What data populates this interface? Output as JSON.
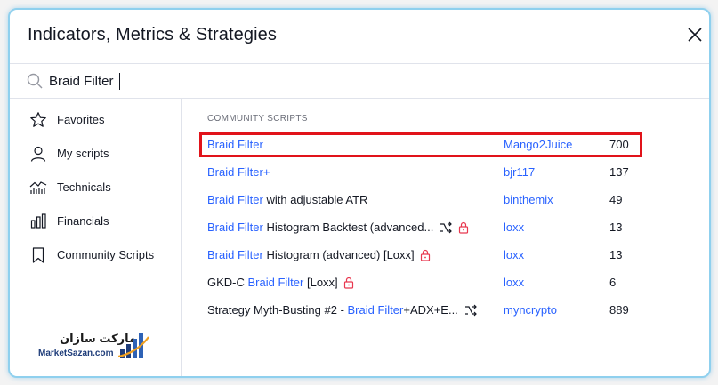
{
  "dialog": {
    "title": "Indicators, Metrics & Strategies",
    "close_icon": "close-icon"
  },
  "search": {
    "value": "Braid Filter",
    "icon": "search-icon"
  },
  "sidebar": {
    "items": [
      {
        "label": "Favorites",
        "icon": "star-icon"
      },
      {
        "label": "My scripts",
        "icon": "user-icon"
      },
      {
        "label": "Technicals",
        "icon": "technicals-icon"
      },
      {
        "label": "Financials",
        "icon": "bar-chart-icon"
      },
      {
        "label": "Community Scripts",
        "icon": "bookmark-icon"
      }
    ],
    "watermark": {
      "text_fa": "مارکت سازان",
      "text_en": "MarketSazan.com"
    }
  },
  "results": {
    "section_label": "COMMUNITY SCRIPTS",
    "rows": [
      {
        "prefix": "",
        "match": "Braid Filter",
        "suffix": "",
        "author": "Mango2Juice",
        "count": "700",
        "highlighted": true
      },
      {
        "prefix": "",
        "match": "Braid Filter",
        "suffix": "+",
        "author": "bjr117",
        "count": "137"
      },
      {
        "prefix": "",
        "match": "Braid Filter",
        "suffix": " with adjustable ATR",
        "author": "binthemix",
        "count": "49"
      },
      {
        "prefix": "",
        "match": "Braid Filter",
        "suffix": " Histogram Backtest (advanced...",
        "author": "loxx",
        "count": "13",
        "icons": [
          "strategy-icon",
          "lock-icon"
        ]
      },
      {
        "prefix": "",
        "match": "Braid Filter",
        "suffix": " Histogram (advanced) [Loxx]",
        "author": "loxx",
        "count": "13",
        "icons": [
          "lock-icon"
        ]
      },
      {
        "prefix": "GKD-C ",
        "match": "Braid Filter",
        "suffix": " [Loxx]",
        "author": "loxx",
        "count": "6",
        "icons": [
          "lock-icon"
        ]
      },
      {
        "prefix": "Strategy Myth-Busting #2 - ",
        "match": "Braid Filter",
        "suffix": "+ADX+E...",
        "author": "myncrypto",
        "count": "889",
        "icons": [
          "strategy-icon"
        ]
      }
    ]
  },
  "colors": {
    "accent": "#2962ff",
    "highlight_border": "#e1131a",
    "lock": "#e8384f",
    "frame": "#8fd0ee"
  }
}
